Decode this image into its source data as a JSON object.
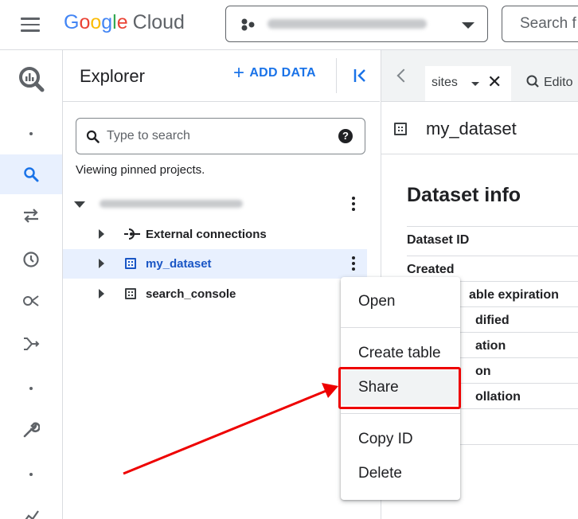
{
  "header": {
    "logo": {
      "g1": "G",
      "g2": "o",
      "g3": "o",
      "g4": "g",
      "g5": "l",
      "g6": "e",
      "cloud": "Cloud"
    },
    "search_placeholder": "Search f"
  },
  "explorer": {
    "title": "Explorer",
    "add_data_label": "ADD DATA",
    "search_placeholder": "Type to search",
    "help": "?",
    "pinned_note": "Viewing pinned projects.",
    "tree": {
      "external_connections": "External connections",
      "my_dataset": "my_dataset",
      "search_console": "search_console"
    }
  },
  "tabs": {
    "sites_label": "sites",
    "close": "✕",
    "editor_label": "Edito"
  },
  "dataset_panel": {
    "title": "my_dataset",
    "info_title": "Dataset info",
    "fields": [
      "Dataset ID",
      "Created",
      "able expiration",
      "dified",
      "ation",
      "on",
      "ollation"
    ]
  },
  "context_menu": {
    "items": [
      "Open",
      "Create table",
      "Share",
      "Copy ID",
      "Delete"
    ]
  },
  "colors": {
    "accent": "#1a73e8",
    "selected_row": "#e8f0fe",
    "highlight": "#ee0000"
  }
}
